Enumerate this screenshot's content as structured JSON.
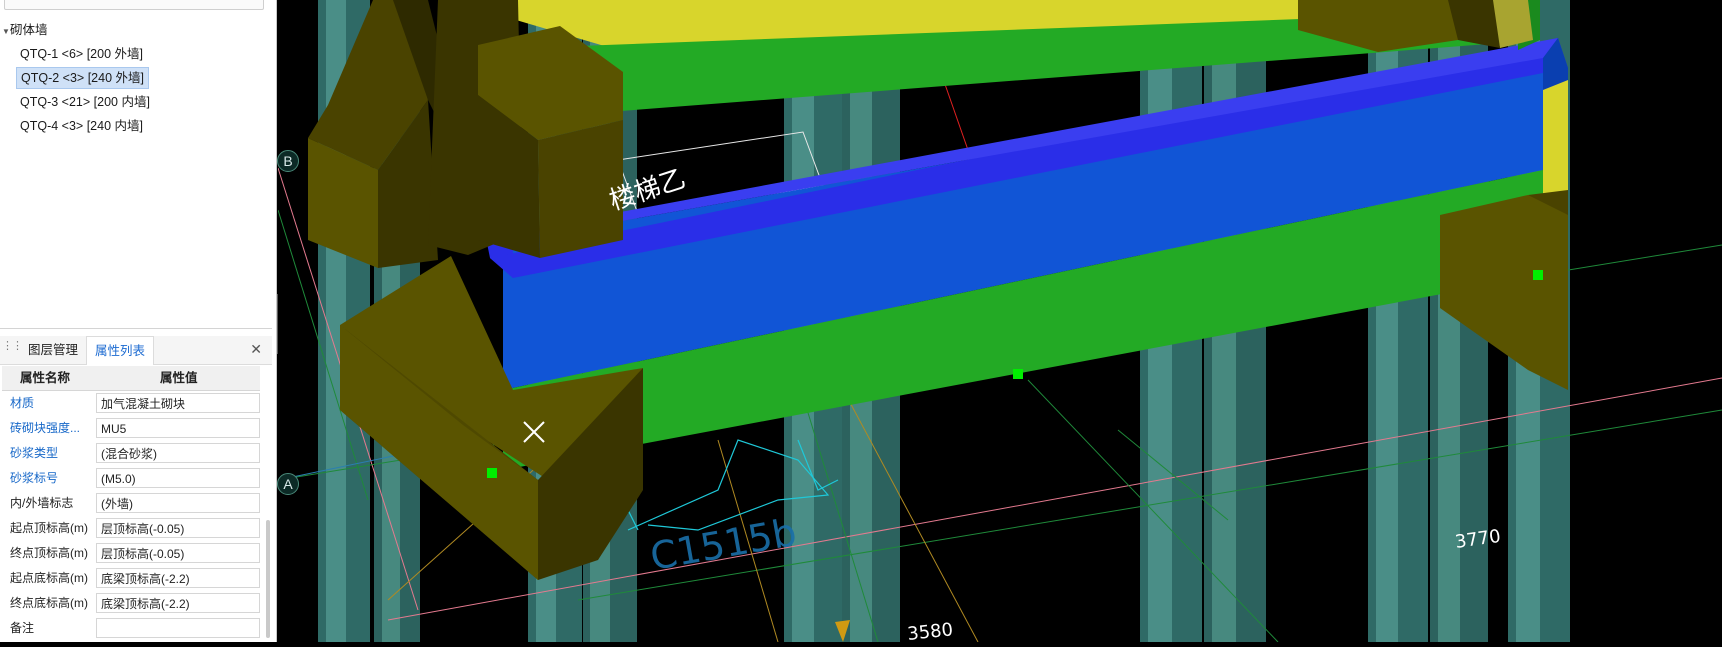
{
  "tree": {
    "group": "砌体墙",
    "items": [
      {
        "label": "QTQ-1 <6> [200 外墙]",
        "selected": false
      },
      {
        "label": "QTQ-2 <3> [240 外墙]",
        "selected": true
      },
      {
        "label": "QTQ-3 <21> [200 内墙]",
        "selected": false
      },
      {
        "label": "QTQ-4 <3> [240 内墙]",
        "selected": false
      }
    ]
  },
  "tabs": {
    "layers": "图层管理",
    "properties": "属性列表",
    "active": "properties"
  },
  "props": {
    "header_name": "属性名称",
    "header_value": "属性值",
    "rows": [
      {
        "name": "材质",
        "value": "加气混凝土砌块",
        "highlight": true
      },
      {
        "name": "砖砌块强度...",
        "value": "MU5",
        "highlight": true
      },
      {
        "name": "砂浆类型",
        "value": "(混合砂浆)",
        "highlight": true
      },
      {
        "name": "砂浆标号",
        "value": "(M5.0)",
        "highlight": true
      },
      {
        "name": "内/外墙标志",
        "value": "(外墙)",
        "highlight": false
      },
      {
        "name": "起点顶标高(m)",
        "value": "层顶标高(-0.05)",
        "highlight": false
      },
      {
        "name": "终点顶标高(m)",
        "value": "层顶标高(-0.05)",
        "highlight": false
      },
      {
        "name": "起点底标高(m)",
        "value": "底梁顶标高(-2.2)",
        "highlight": false
      },
      {
        "name": "终点底标高(m)",
        "value": "底梁顶标高(-2.2)",
        "highlight": false
      },
      {
        "name": "备注",
        "value": "",
        "highlight": false
      }
    ]
  },
  "viewport": {
    "axis_b": "B",
    "axis_a": "A",
    "stair_label": "楼梯乙",
    "window_label": "C1515b",
    "dim_right": "3770",
    "dim_bottom": "3580"
  },
  "icons": {
    "collapse": "chevron-left-icon",
    "close": "close-icon",
    "grip": "drag-grip-icon",
    "cursor": "crosshair-cursor-icon"
  },
  "colors": {
    "beam_blue": "#1155d6",
    "beam_edge": "#2a2ee8",
    "slab_green": "#23aa25",
    "slab_yellow": "#d8d52c",
    "pier_olive": "#5a5400",
    "column": "#3e7a74",
    "select_bg": "#cfe1f7",
    "link_blue": "#1667c8",
    "handle": "#00ee00"
  }
}
